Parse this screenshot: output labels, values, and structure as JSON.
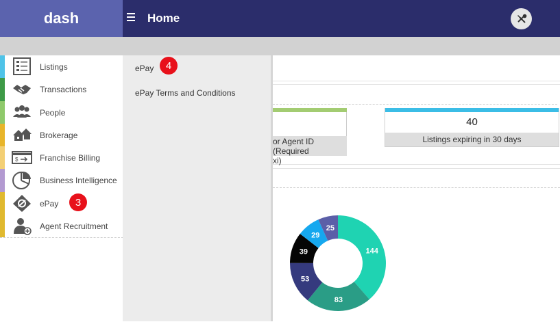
{
  "header": {
    "brand": "dash",
    "title": "Home"
  },
  "sidebar": {
    "items": [
      {
        "label": "Listings",
        "stripe": "#4fc3e8",
        "icon": "listings-icon"
      },
      {
        "label": "Transactions",
        "stripe": "#3e9a47",
        "icon": "handshake-icon"
      },
      {
        "label": "People",
        "stripe": "#8fc96b",
        "icon": "people-icon"
      },
      {
        "label": "Brokerage",
        "stripe": "#e8b52a",
        "icon": "houses-icon"
      },
      {
        "label": "Franchise Billing",
        "stripe": "#f3cf74",
        "icon": "billing-icon"
      },
      {
        "label": "Business Intelligence",
        "stripe": "#b39ad1",
        "icon": "pie-chart-icon"
      },
      {
        "label": "ePay",
        "stripe": "#e0b92f",
        "icon": "epay-icon"
      },
      {
        "label": "Agent Recruitment",
        "stripe": "#e0b92f",
        "icon": "add-person-icon"
      }
    ]
  },
  "submenu": {
    "items": [
      "ePay",
      "ePay Terms and Conditions"
    ]
  },
  "badges": {
    "sidebar_epay": "3",
    "submenu_epay": "4"
  },
  "cards": {
    "agent_id_partial_line1": "or Agent ID (Required",
    "agent_id_partial_line2": "xi)",
    "listings_expiring_value": "40",
    "listings_expiring_label": "Listings expiring in 30 days"
  },
  "chart_data": {
    "type": "pie",
    "variant": "donut",
    "values": [
      144,
      83,
      53,
      39,
      29,
      25
    ],
    "colors": [
      "#1fd3b2",
      "#2a9d86",
      "#353a7e",
      "#050505",
      "#16a8ef",
      "#5b5fa8"
    ]
  }
}
